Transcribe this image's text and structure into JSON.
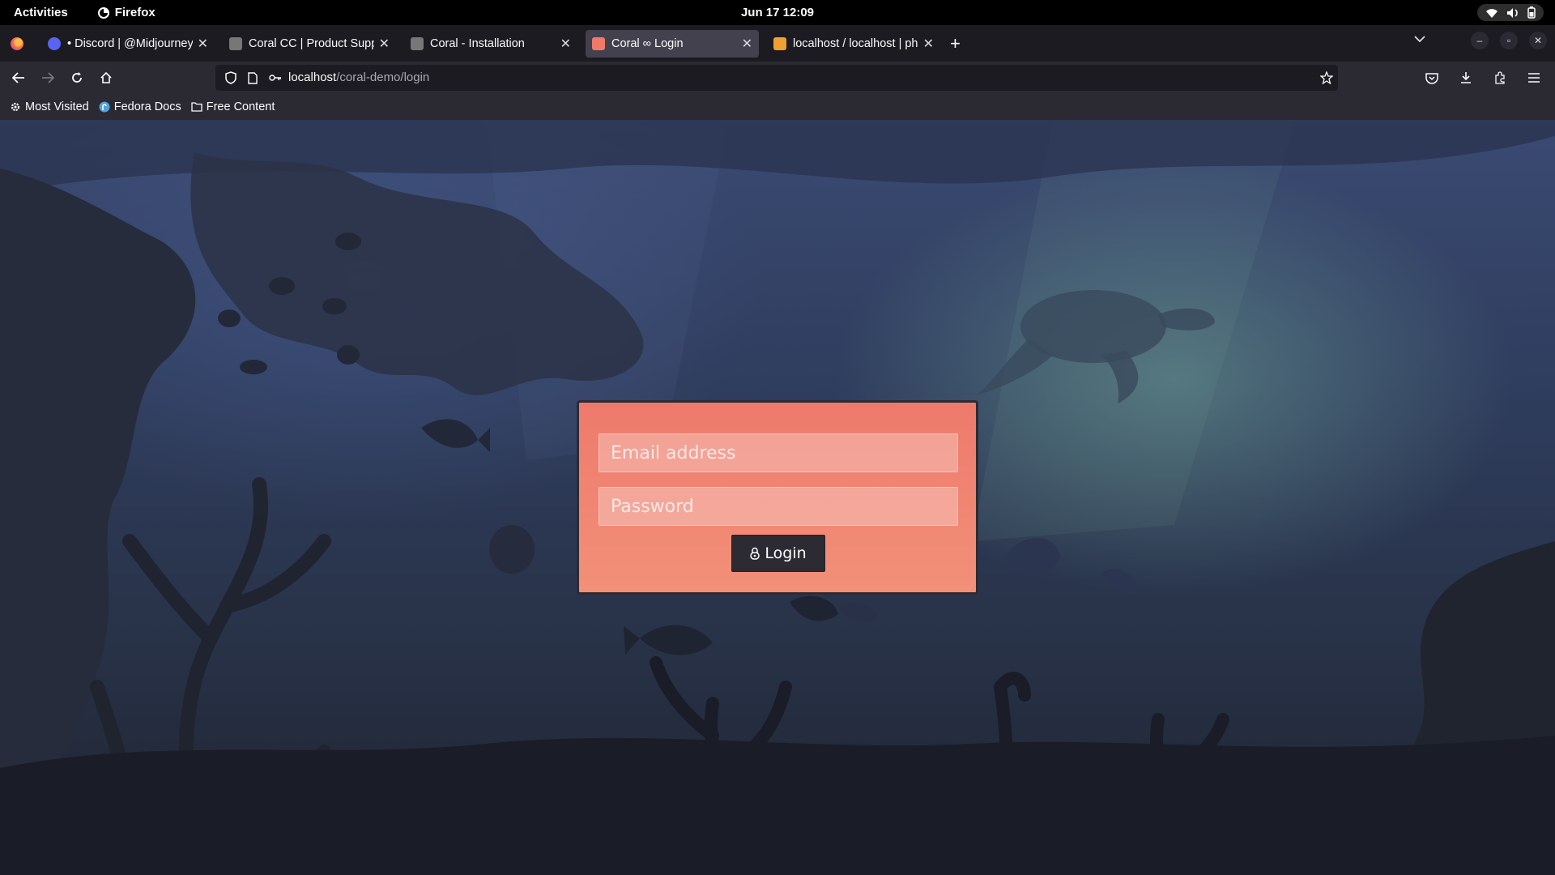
{
  "topbar": {
    "activities": "Activities",
    "app_name": "Firefox",
    "clock": "Jun 17  12:09"
  },
  "tabs": [
    {
      "title": "• Discord | @Midjourney Bot",
      "favicon_color": "#5865f2",
      "active": false
    },
    {
      "title": "Coral CC | Product Support",
      "favicon_color": "#dddddd",
      "active": false
    },
    {
      "title": "Coral - Installation",
      "favicon_color": "#dddddd",
      "active": false
    },
    {
      "title": "Coral ∞ Login",
      "favicon_color": "#f07a6a",
      "active": true
    },
    {
      "title": "localhost / localhost | phpMyAdmin",
      "favicon_color": "#f0a030",
      "active": false
    }
  ],
  "urlbar": {
    "host": "localhost",
    "path": "/coral-demo/login"
  },
  "bookmarks": {
    "most_visited": "Most Visited",
    "fedora_docs": "Fedora Docs",
    "free_content": "Free Content"
  },
  "login": {
    "email_placeholder": "Email address",
    "password_placeholder": "Password",
    "button_label": "Login"
  },
  "colors": {
    "card_top": "#ee7a6c",
    "card_bottom": "#f29078",
    "button_bg": "#2c2b33"
  }
}
